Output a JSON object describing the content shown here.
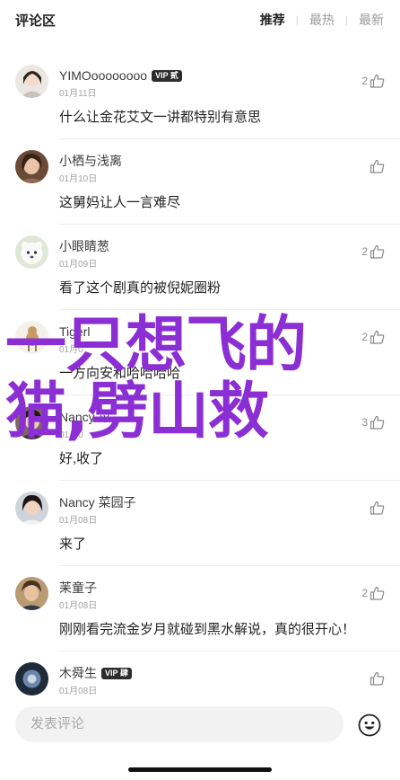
{
  "header": {
    "title": "评论区",
    "tabs": [
      {
        "label": "推荐",
        "active": true
      },
      {
        "label": "最热",
        "active": false
      },
      {
        "label": "最新",
        "active": false
      }
    ]
  },
  "comments": [
    {
      "name": "YIMOoooooooo",
      "vip": "VIP 贰",
      "date": "01月11日",
      "text": "什么让金花艾文一讲都特别有意思",
      "likes": "2"
    },
    {
      "name": "小栖与浅离",
      "vip": "",
      "date": "01月10日",
      "text": "这舅妈让人一言难尽",
      "likes": ""
    },
    {
      "name": "小眼睛葱",
      "vip": "",
      "date": "01月09日",
      "text": "看了这个剧真的被倪妮圈粉",
      "likes": "2"
    },
    {
      "name": "Tigerl",
      "vip": "",
      "date": "01月0",
      "text": "一方向安和哈哈哈哈",
      "likes": "2"
    },
    {
      "name": "Nancy 菜",
      "vip": "",
      "date": "01月0",
      "text": "好,收了",
      "likes": "3"
    },
    {
      "name": "Nancy 菜园子",
      "vip": "",
      "date": "01月08日",
      "text": "来了",
      "likes": ""
    },
    {
      "name": "苿童子",
      "vip": "",
      "date": "01月08日",
      "text": "刚刚看完流金岁月就碰到黑水解说，真的很开心！",
      "likes": "2"
    },
    {
      "name": "木舜生",
      "vip": "VIP 肆",
      "date": "01月08日",
      "text": "",
      "likes": ""
    }
  ],
  "overlay": {
    "line1": "一只想飞的",
    "line2": "猫,劈山救",
    "color": "#8b2fd4"
  },
  "bottom_bar": {
    "placeholder": "发表评论",
    "emoji_icon": "smiley-icon"
  },
  "colors": {
    "text_primary": "#222222",
    "text_secondary": "#a3a3a3",
    "input_bg": "#f2f2f2"
  }
}
